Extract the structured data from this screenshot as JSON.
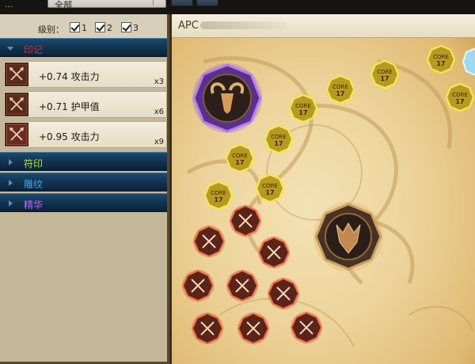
{
  "top": {
    "label": "...",
    "dropdown_value": "全部"
  },
  "levels": {
    "label": "级别：",
    "options": [
      {
        "label": "1",
        "checked": true
      },
      {
        "label": "2",
        "checked": true
      },
      {
        "label": "3",
        "checked": true
      }
    ]
  },
  "categories": [
    {
      "name": "印记",
      "color": "#d8312c",
      "expanded": true
    },
    {
      "name": "符印",
      "color": "#b8e238",
      "expanded": false
    },
    {
      "name": "雕纹",
      "color": "#36a9ee",
      "expanded": false
    },
    {
      "name": "精华",
      "color": "#b76cff",
      "expanded": false
    }
  ],
  "items": [
    {
      "stat": "+0.74 攻击力",
      "count": "x3",
      "icon": "crossed-swords-icon"
    },
    {
      "stat": "+0.71 护甲值",
      "count": "x6",
      "icon": "crossed-swords-icon"
    },
    {
      "stat": "+0.95 攻击力",
      "count": "x9",
      "icon": "crossed-swords-icon"
    }
  ],
  "map": {
    "title": "APC",
    "core_label": "CORE",
    "core_level": "17"
  },
  "colors": {
    "category_bar": "#12334f",
    "core_glow": "#f2e22a",
    "red_glow": "#e2411f",
    "purple_frame": "#8e4bd6",
    "blue_frame": "#6ec8e8"
  }
}
